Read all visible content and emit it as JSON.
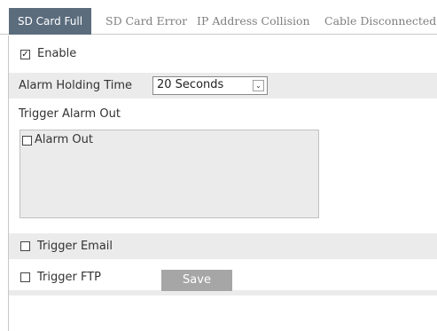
{
  "tabs": [
    {
      "label": "SD Card Full",
      "active": true
    },
    {
      "label": "SD Card Error",
      "active": false
    },
    {
      "label": "IP Address Collision",
      "active": false
    },
    {
      "label": "Cable Disconnected",
      "active": false
    }
  ],
  "enable": {
    "label": "Enable",
    "checked": true
  },
  "alarm_holding_time": {
    "label": "Alarm Holding Time",
    "value": "20 Seconds"
  },
  "trigger_alarm_out": {
    "label": "Trigger Alarm Out",
    "options": [
      {
        "label": "Alarm Out",
        "checked": false
      }
    ]
  },
  "trigger_email": {
    "label": "Trigger Email",
    "checked": false
  },
  "trigger_ftp": {
    "label": "Trigger FTP",
    "checked": false
  },
  "save_label": "Save",
  "colors": {
    "active_tab": "#5b6c7d",
    "row_shade": "#ebebeb",
    "save_button": "#a6a6a6"
  },
  "icons": {
    "checkbox": "checkbox-icon",
    "dropdown": "chevron-down-icon"
  }
}
